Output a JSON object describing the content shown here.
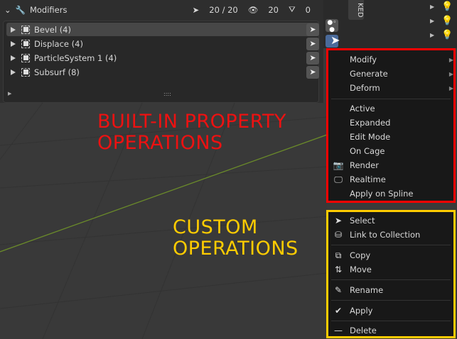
{
  "header": {
    "title": "Modifiers",
    "selected": "20 / 20",
    "visible": "20",
    "filtered": "0"
  },
  "modifiers": [
    {
      "label": "Bevel (4)"
    },
    {
      "label": "Displace (4)"
    },
    {
      "label": "ParticleSystem 1 (4)"
    },
    {
      "label": "Subsurf (8)"
    }
  ],
  "side_tab": "KED",
  "builtin_menu": [
    {
      "label": "Modify",
      "submenu": true
    },
    {
      "label": "Generate",
      "submenu": true
    },
    {
      "label": "Deform",
      "submenu": true
    },
    {
      "label": "Active"
    },
    {
      "label": "Expanded"
    },
    {
      "label": "Edit Mode"
    },
    {
      "label": "On Cage"
    },
    {
      "label": "Render",
      "icon": "camera-icon"
    },
    {
      "label": "Realtime",
      "icon": "monitor-icon"
    },
    {
      "label": "Apply on Spline"
    }
  ],
  "custom_menu": [
    {
      "label": "Select",
      "icon": "cursor-icon"
    },
    {
      "label": "Link to Collection",
      "icon": "collection-icon"
    },
    {
      "label": "Copy",
      "icon": "copy-icon"
    },
    {
      "label": "Move",
      "icon": "move-icon"
    },
    {
      "label": "Rename",
      "icon": "pencil-icon"
    },
    {
      "label": "Apply",
      "icon": "check-icon"
    },
    {
      "label": "Delete",
      "icon": "minus-icon"
    }
  ],
  "annotations": {
    "builtin": "BUILT-IN PROPERTY\nOPERATIONS",
    "custom": "CUSTOM\nOPERATIONS"
  },
  "colors": {
    "builtin_box": "#ff0000",
    "custom_box": "#ffcc00",
    "selected_button": "#4a6a9a"
  }
}
